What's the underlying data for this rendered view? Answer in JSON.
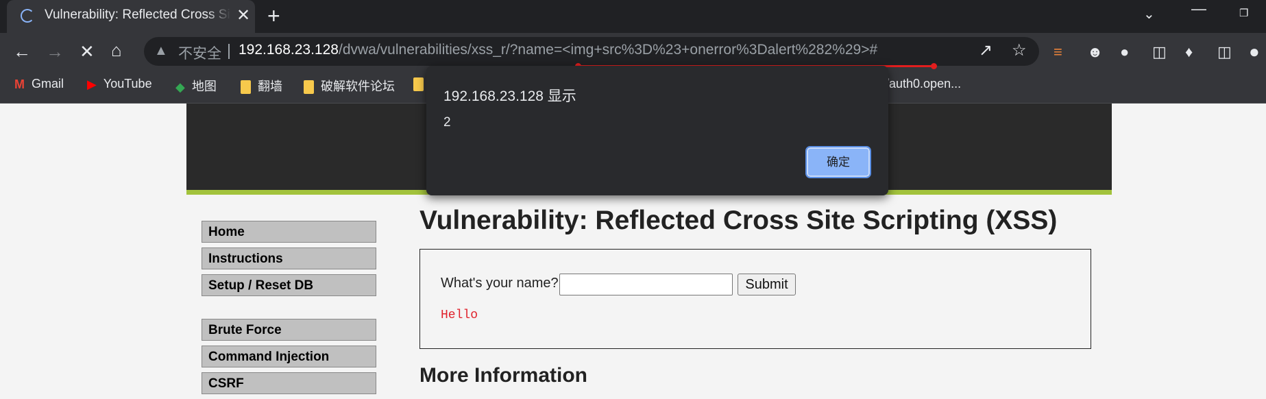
{
  "browser": {
    "tab_title": "Vulnerability: Reflected Cross Site Scripting (XSS) :: Damn Vulnerable Web Application",
    "tab_close": "✕",
    "new_tab": "+",
    "security_label": "不安全",
    "url_host": "192.168.23.128",
    "url_path": "/dvwa/vulnerabilities/xss_r/?name=<img+src%3D%23+onerror%3Dalert%282%29>#",
    "highlight_color": "#e21e1e"
  },
  "bookmarks": [
    {
      "label": "Gmail",
      "icon": "gmail-icon"
    },
    {
      "label": "YouTube",
      "icon": "youtube-icon"
    },
    {
      "label": "地图",
      "icon": "maps-icon"
    },
    {
      "label": "翻墙",
      "icon": "folder-icon"
    },
    {
      "label": "破解软件论坛",
      "icon": "folder-icon"
    },
    {
      "label": "",
      "icon": "folder-icon"
    },
    {
      "label": "/auth0.open...",
      "icon": "link-icon"
    }
  ],
  "alert": {
    "title": "192.168.23.128 显示",
    "message": "2",
    "ok_label": "确定"
  },
  "page": {
    "title": "Vulnerability: Reflected Cross Site Scripting (XSS)",
    "form_label": "What's your name?",
    "input_value": "",
    "submit_label": "Submit",
    "output_text": "Hello",
    "more_info_heading": "More Information"
  },
  "menu": {
    "group1": [
      "Home",
      "Instructions",
      "Setup / Reset DB"
    ],
    "group2": [
      "Brute Force",
      "Command Injection",
      "CSRF"
    ]
  },
  "colors": {
    "dvwa_header": "#2a2a2a",
    "dvwa_accent": "#a2c23c",
    "hello_text": "#e0212b"
  }
}
